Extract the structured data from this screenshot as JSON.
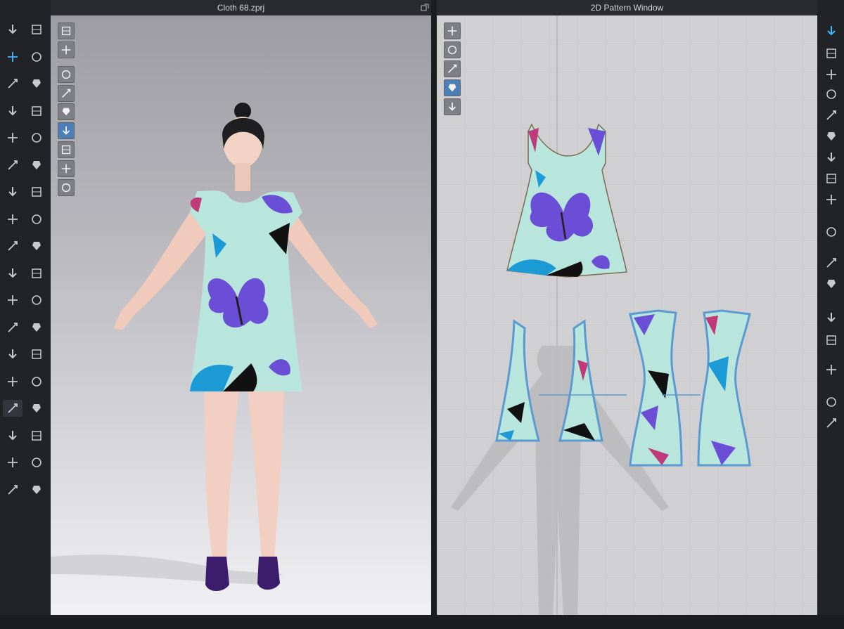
{
  "windows": {
    "left_title": "Cloth 68.zprj",
    "right_title": "2D Pattern Window"
  },
  "icons": {
    "left_toolbar": [
      "arrow-down-icon",
      "walk-icon",
      "move-icon",
      "fold-icon",
      "edit-icon",
      "pin-icon",
      "tack-icon",
      "steam-icon",
      "shirt-icon",
      "hanger-icon",
      "line-icon",
      "brush-icon",
      "rotate-icon",
      "arrange-icon",
      "selection-icon",
      "box-icon",
      "rope-icon",
      "lock-icon",
      "measure-icon",
      "button-icon",
      "zipper-icon",
      "shirt2-icon",
      "buttonhole-icon",
      "sew-icon",
      "pattern-icon",
      "glue-icon",
      "avatar-icon",
      "rect-icon",
      "fabric-icon",
      "grid-icon",
      "elastic-icon",
      "fit-icon",
      "belt-icon",
      "seam-icon",
      "heal-icon",
      "tape-icon"
    ],
    "view3d_toolbar": [
      "garment-icon",
      "shirt-view-icon",
      "show-garment-icon",
      "texture-icon",
      "avatar-view-icon",
      "pattern-view-icon",
      "box-view-icon",
      "skin-icon",
      "globe-icon"
    ],
    "view2d_toolbar": [
      "needle-icon",
      "show-shirt-icon",
      "info-icon",
      "fabric-view-icon",
      "lock-shirt-icon"
    ],
    "right_toolbar": [
      "select-icon",
      "segment-icon",
      "polygon-icon",
      "rectangle-icon",
      "internal-icon",
      "dart-icon",
      "trace-icon",
      "cut-icon",
      "curve-icon",
      "notch-icon",
      "ruler-icon",
      "measure-line-icon",
      "text-icon",
      "text-large-icon",
      "grid-pattern-icon",
      "avatar2d-icon",
      "figure-icon"
    ]
  },
  "colors": {
    "accent": "#3fb6ff",
    "dress_fabric": "#b9e6dc",
    "butterfly_purple": "#6a4fd6",
    "butterfly_blue": "#1c9ad6"
  }
}
